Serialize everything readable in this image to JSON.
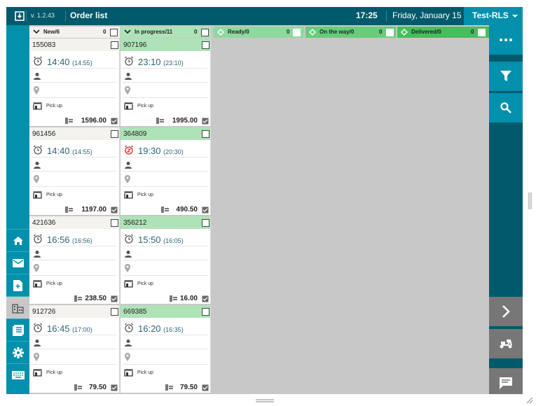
{
  "topbar": {
    "version": "v. 1.2.43",
    "title": "Order list",
    "time": "17:25",
    "date": "Friday, January 15",
    "user": "Test-RLS",
    "app_icon": "download-box-icon"
  },
  "columns": [
    {
      "label": "New/6",
      "count": "0",
      "color": "#f4f2ef",
      "icon": "chevron-down-icon"
    },
    {
      "label": "In progress/11",
      "count": "0",
      "color": "#aee3b8",
      "icon": "chevron-down-icon"
    },
    {
      "label": "Ready/0",
      "count": "0",
      "color": "#8fd99e",
      "icon": "diamond-arrows-icon"
    },
    {
      "label": "On the way/0",
      "count": "0",
      "color": "#68cc7a",
      "icon": "diamond-arrows-icon"
    },
    {
      "label": "Delivered/0",
      "count": "0",
      "color": "#47bd5d",
      "icon": "diamond-arrows-icon"
    }
  ],
  "orders_new": [
    {
      "id": "155083",
      "time": "14:40",
      "time_sub": "(14:55)",
      "delivery": "Pick up",
      "amount": "1596.00"
    },
    {
      "id": "961456",
      "time": "14:40",
      "time_sub": "(14:55)",
      "delivery": "Pick up",
      "amount": "1197.00"
    },
    {
      "id": "421636",
      "time": "16:56",
      "time_sub": "(16:56)",
      "delivery": "Pick up",
      "amount": "238.50"
    },
    {
      "id": "912726",
      "time": "16:45",
      "time_sub": "(17:00)",
      "delivery": "Pick up",
      "amount": "79.50"
    }
  ],
  "orders_in_progress": [
    {
      "id": "907196",
      "time": "23:10",
      "time_sub": "(23:10)",
      "delivery": "Pick up",
      "amount": "1995.00",
      "alarm": false
    },
    {
      "id": "364809",
      "time": "19:30",
      "time_sub": "(20:30)",
      "delivery": "Pick up",
      "amount": "490.50",
      "alarm": true
    },
    {
      "id": "356212",
      "time": "15:50",
      "time_sub": "(16:05)",
      "delivery": "Pick up",
      "amount": "16.00",
      "alarm": false
    },
    {
      "id": "669385",
      "time": "16:20",
      "time_sub": "(16:35)",
      "delivery": "Pick up",
      "amount": "79.50",
      "alarm": false
    }
  ],
  "left_nav": [
    "home-icon",
    "mail-icon",
    "add-document-icon",
    "building-icon",
    "list-icon",
    "gear-icon",
    "keyboard-icon"
  ],
  "right_nav": [
    "more-icon",
    "filter-icon",
    "search-icon",
    "chevron-right-icon",
    "scooter-icon",
    "chat-icon"
  ],
  "colors": {
    "top_bar": "#005a6b",
    "accent": "#0290ad",
    "time_text": "#2e6479",
    "alarm_red": "#d02a2a"
  }
}
